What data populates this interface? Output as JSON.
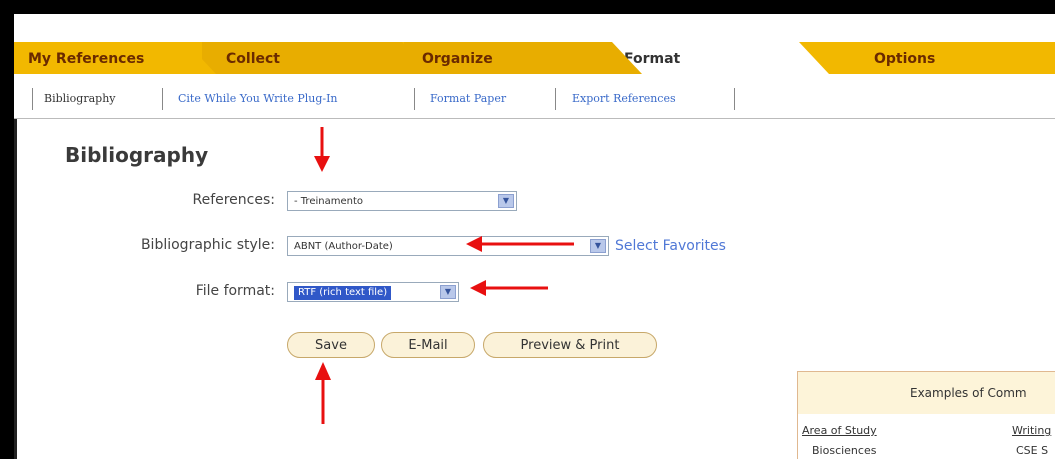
{
  "tabs": {
    "my_references": "My References",
    "collect": "Collect",
    "organize": "Organize",
    "format": "Format",
    "options": "Options"
  },
  "subnav": {
    "bibliography": "Bibliography",
    "cwyw": "Cite While You Write Plug-In",
    "format_paper": "Format Paper",
    "export": "Export References"
  },
  "page": {
    "title": "Bibliography"
  },
  "form": {
    "references_label": "References:",
    "references_value": "- Treinamento",
    "style_label": "Bibliographic style:",
    "style_value": "ABNT (Author-Date)",
    "select_favorites": "Select Favorites",
    "format_label": "File format:",
    "format_value": "RTF (rich text file)"
  },
  "buttons": {
    "save": "Save",
    "email": "E-Mail",
    "preview": "Preview & Print"
  },
  "examples": {
    "title": "Examples of Comm",
    "col1_head": "Area of Study",
    "col2_head": "Writing",
    "row1_col1": "Biosciences",
    "row1_col2": "CSE S"
  },
  "colors": {
    "tab_bar": "#f2b800",
    "arrow": "#e81010",
    "link": "#5078d6"
  }
}
